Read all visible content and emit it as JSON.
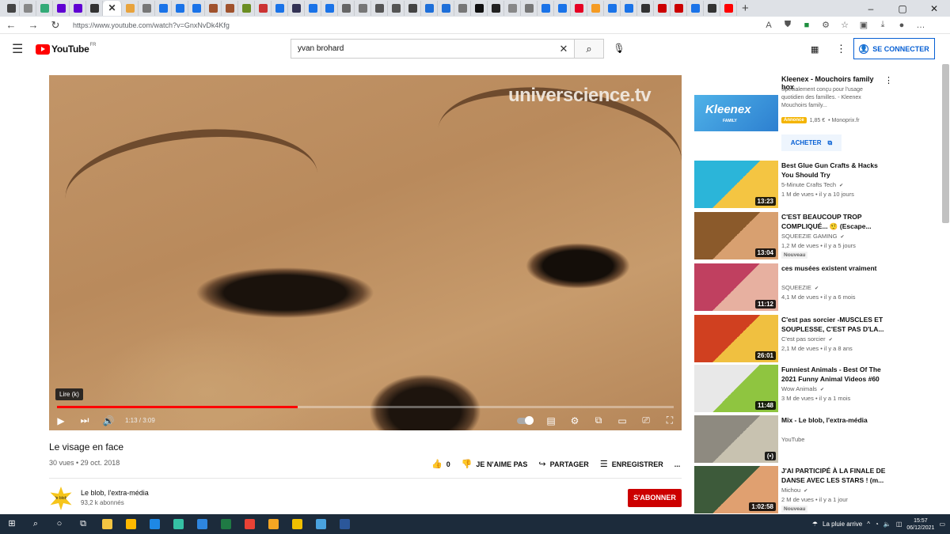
{
  "browser": {
    "url": "https://www.youtube.com/watch?v=GnxNvDk4Kfg",
    "tab_count_hint": "many",
    "tabs": [
      {
        "icon": "window-icon",
        "color": "#444"
      },
      {
        "icon": "page-icon",
        "color": "#888"
      },
      {
        "icon": "calendar-icon",
        "color": "#3a7"
      },
      {
        "icon": "yahoo-icon",
        "color": "#6001d2"
      },
      {
        "icon": "mail-icon",
        "color": "#6001d2"
      },
      {
        "icon": "tb-icon",
        "color": "#333"
      },
      {
        "icon": "close-icon",
        "color": "#333",
        "active": true
      },
      {
        "icon": "bookmark-icon",
        "color": "#e8a33d"
      },
      {
        "icon": "p-icon",
        "color": "#777"
      },
      {
        "icon": "bing-icon",
        "color": "#1a73e8"
      },
      {
        "icon": "bing-icon",
        "color": "#1a73e8"
      },
      {
        "icon": "bing-icon",
        "color": "#1a73e8"
      },
      {
        "icon": "avatar-icon",
        "color": "#a0522d"
      },
      {
        "icon": "avatar-icon",
        "color": "#a0522d"
      },
      {
        "icon": "avatar-icon",
        "color": "#6b8e23"
      },
      {
        "icon": "flag-icon",
        "color": "#cc3333"
      },
      {
        "icon": "bing-icon",
        "color": "#1a73e8"
      },
      {
        "icon": "news-icon",
        "color": "#335"
      },
      {
        "icon": "bing-icon",
        "color": "#1a73e8"
      },
      {
        "icon": "bing-icon",
        "color": "#1a73e8"
      },
      {
        "icon": "wikipedia-icon",
        "color": "#666"
      },
      {
        "icon": "p-icon",
        "color": "#777"
      },
      {
        "icon": "doc-icon",
        "color": "#555"
      },
      {
        "icon": "doc-icon",
        "color": "#555"
      },
      {
        "icon": "wikipedia-icon",
        "color": "#444"
      },
      {
        "icon": "globe-icon",
        "color": "#1e6fd9"
      },
      {
        "icon": "globe-icon",
        "color": "#1e6fd9"
      },
      {
        "icon": "h-icon",
        "color": "#777"
      },
      {
        "icon": "circle-icon",
        "color": "#111"
      },
      {
        "icon": "k-icon",
        "color": "#222"
      },
      {
        "icon": "a-icon",
        "color": "#888"
      },
      {
        "icon": "p-icon",
        "color": "#777"
      },
      {
        "icon": "bing-icon",
        "color": "#1a73e8"
      },
      {
        "icon": "bing-icon",
        "color": "#1a73e8"
      },
      {
        "icon": "pinterest-icon",
        "color": "#e60023"
      },
      {
        "icon": "heart-icon",
        "color": "#f59b23"
      },
      {
        "icon": "bing-icon",
        "color": "#1a73e8"
      },
      {
        "icon": "bing-icon",
        "color": "#1a73e8"
      },
      {
        "icon": "lm-icon",
        "color": "#333"
      },
      {
        "icon": "h-icon",
        "color": "#c00"
      },
      {
        "icon": "h-icon",
        "color": "#c00"
      },
      {
        "icon": "bing-icon",
        "color": "#1a73e8"
      },
      {
        "icon": "tb-icon",
        "color": "#333"
      },
      {
        "icon": "youtube-icon",
        "color": "#f00"
      }
    ],
    "new_tab": "+",
    "window_controls": [
      "–",
      "▢",
      "✕"
    ]
  },
  "youtube": {
    "logo_text": "YouTube",
    "region": "FR",
    "search": {
      "value": "yvan brohard"
    },
    "signin_label": "SE CONNECTER"
  },
  "player": {
    "watermark": "universcience.tv",
    "tooltip": "Lire (k)",
    "time": "1:13 / 3:09",
    "progress": 0.39
  },
  "video": {
    "title": "Le visage en face",
    "meta": "30 vues • 29 oct. 2018",
    "likes": "0",
    "dislike_label": "JE N'AIME PAS",
    "share_label": "PARTAGER",
    "save_label": "ENREGISTRER",
    "more_label": "...",
    "channel": {
      "name": "Le blob, l'extra-média",
      "subs": "93,2 k abonnés",
      "avatar_text": "le blob"
    },
    "subscribe_label": "S'ABONNER"
  },
  "ad": {
    "title": "Kleenex - Mouchoirs family box",
    "desc": "Spécialement conçu pour l'usage quotidien des familles. - Kleenex Mouchoirs family...",
    "badge": "Annonce",
    "price": "1,85 €",
    "seller": "• Monoprix.fr",
    "buy_label": "ACHETER",
    "thumb_brand": "Kleenex",
    "thumb_sub": "FAMILY"
  },
  "recommendations": [
    {
      "title": "Best Glue Gun Crafts & Hacks You Should Try",
      "channel": "5-Minute Crafts Tech",
      "views": "1 M de vues • il y a 10 jours",
      "duration": "13:23",
      "colors": [
        "#2bb5d9",
        "#f4c542"
      ]
    },
    {
      "title": "C'EST BEAUCOUP TROP COMPLIQUÉ... 🤨 (Escape...",
      "channel": "SQUEEZIE GAMING",
      "views": "1,2 M de vues • il y a 5 jours",
      "duration": "13:04",
      "badge": "Nouveau",
      "colors": [
        "#8b5a2b",
        "#d8a070"
      ]
    },
    {
      "title": "ces musées existent vraiment",
      "channel": "SQUEEZIE",
      "views": "4,1 M de vues • il y a 6 mois",
      "duration": "11:12",
      "colors": [
        "#c04060",
        "#e7b0a0"
      ]
    },
    {
      "title": "C'est pas sorcier -MUSCLES ET SOUPLESSE, C'EST PAS D'LA...",
      "channel": "C'est pas sorcier",
      "views": "2,1 M de vues • il y a 8 ans",
      "duration": "26:01",
      "colors": [
        "#d04020",
        "#f0c040"
      ]
    },
    {
      "title": "Funniest Animals - Best Of The 2021 Funny Animal Videos #60",
      "channel": "Wow Animals",
      "views": "3 M de vues • il y a 1 mois",
      "duration": "11:48",
      "colors": [
        "#e8e8e8",
        "#8fc540"
      ]
    },
    {
      "title": "Mix - Le blob, l'extra-média",
      "channel": "YouTube",
      "views": "",
      "duration": "(•)",
      "colors": [
        "#8e8a80",
        "#c8c2b0"
      ]
    },
    {
      "title": "J'AI PARTICIPÉ À LA FINALE DE DANSE AVEC LES STARS ! (m...",
      "channel": "Michou",
      "views": "2 M de vues • il y a 1 jour",
      "duration": "1:02:58",
      "badge": "Nouveau",
      "colors": [
        "#3d5a3a",
        "#e0a070"
      ]
    }
  ],
  "taskbar": {
    "weather": "La pluie arrive",
    "time": "15:57",
    "date": "06/12/2021",
    "apps": [
      {
        "icon": "file-explorer-icon",
        "color": "#f4c542"
      },
      {
        "icon": "store-icon",
        "color": "#ffb900"
      },
      {
        "icon": "mail-icon",
        "color": "#1e88e5"
      },
      {
        "icon": "edge-icon",
        "color": "#35c1a4"
      },
      {
        "icon": "calendar-icon",
        "color": "#2e86de"
      },
      {
        "icon": "excel-icon",
        "color": "#1f7a44"
      },
      {
        "icon": "chrome-icon",
        "color": "#e94235"
      },
      {
        "icon": "opera-icon",
        "color": "#f5a623"
      },
      {
        "icon": "norton-icon",
        "color": "#f0c000"
      },
      {
        "icon": "photos-icon",
        "color": "#4aa3df"
      },
      {
        "icon": "word-icon",
        "color": "#2b579a"
      }
    ]
  }
}
